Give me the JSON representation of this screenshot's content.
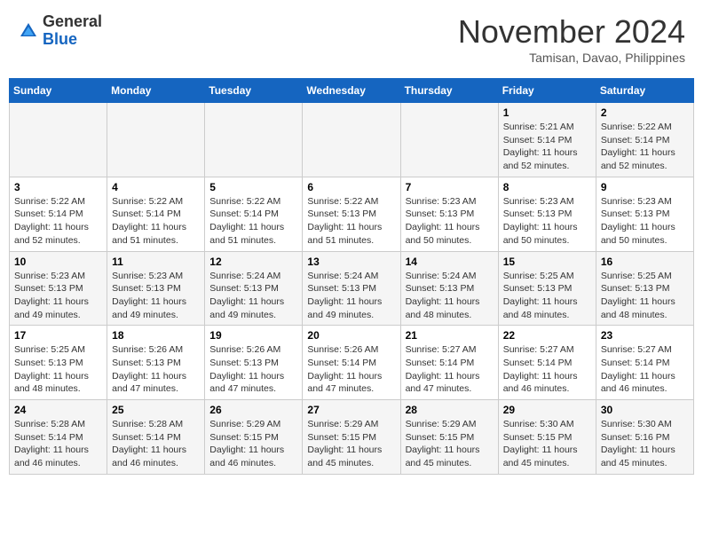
{
  "header": {
    "logo_general": "General",
    "logo_blue": "Blue",
    "month_title": "November 2024",
    "subtitle": "Tamisan, Davao, Philippines"
  },
  "days_of_week": [
    "Sunday",
    "Monday",
    "Tuesday",
    "Wednesday",
    "Thursday",
    "Friday",
    "Saturday"
  ],
  "weeks": [
    {
      "cells": [
        {
          "day": "",
          "detail": ""
        },
        {
          "day": "",
          "detail": ""
        },
        {
          "day": "",
          "detail": ""
        },
        {
          "day": "",
          "detail": ""
        },
        {
          "day": "",
          "detail": ""
        },
        {
          "day": "1",
          "detail": "Sunrise: 5:21 AM\nSunset: 5:14 PM\nDaylight: 11 hours and 52 minutes."
        },
        {
          "day": "2",
          "detail": "Sunrise: 5:22 AM\nSunset: 5:14 PM\nDaylight: 11 hours and 52 minutes."
        }
      ]
    },
    {
      "cells": [
        {
          "day": "3",
          "detail": "Sunrise: 5:22 AM\nSunset: 5:14 PM\nDaylight: 11 hours and 52 minutes."
        },
        {
          "day": "4",
          "detail": "Sunrise: 5:22 AM\nSunset: 5:14 PM\nDaylight: 11 hours and 51 minutes."
        },
        {
          "day": "5",
          "detail": "Sunrise: 5:22 AM\nSunset: 5:14 PM\nDaylight: 11 hours and 51 minutes."
        },
        {
          "day": "6",
          "detail": "Sunrise: 5:22 AM\nSunset: 5:13 PM\nDaylight: 11 hours and 51 minutes."
        },
        {
          "day": "7",
          "detail": "Sunrise: 5:23 AM\nSunset: 5:13 PM\nDaylight: 11 hours and 50 minutes."
        },
        {
          "day": "8",
          "detail": "Sunrise: 5:23 AM\nSunset: 5:13 PM\nDaylight: 11 hours and 50 minutes."
        },
        {
          "day": "9",
          "detail": "Sunrise: 5:23 AM\nSunset: 5:13 PM\nDaylight: 11 hours and 50 minutes."
        }
      ]
    },
    {
      "cells": [
        {
          "day": "10",
          "detail": "Sunrise: 5:23 AM\nSunset: 5:13 PM\nDaylight: 11 hours and 49 minutes."
        },
        {
          "day": "11",
          "detail": "Sunrise: 5:23 AM\nSunset: 5:13 PM\nDaylight: 11 hours and 49 minutes."
        },
        {
          "day": "12",
          "detail": "Sunrise: 5:24 AM\nSunset: 5:13 PM\nDaylight: 11 hours and 49 minutes."
        },
        {
          "day": "13",
          "detail": "Sunrise: 5:24 AM\nSunset: 5:13 PM\nDaylight: 11 hours and 49 minutes."
        },
        {
          "day": "14",
          "detail": "Sunrise: 5:24 AM\nSunset: 5:13 PM\nDaylight: 11 hours and 48 minutes."
        },
        {
          "day": "15",
          "detail": "Sunrise: 5:25 AM\nSunset: 5:13 PM\nDaylight: 11 hours and 48 minutes."
        },
        {
          "day": "16",
          "detail": "Sunrise: 5:25 AM\nSunset: 5:13 PM\nDaylight: 11 hours and 48 minutes."
        }
      ]
    },
    {
      "cells": [
        {
          "day": "17",
          "detail": "Sunrise: 5:25 AM\nSunset: 5:13 PM\nDaylight: 11 hours and 48 minutes."
        },
        {
          "day": "18",
          "detail": "Sunrise: 5:26 AM\nSunset: 5:13 PM\nDaylight: 11 hours and 47 minutes."
        },
        {
          "day": "19",
          "detail": "Sunrise: 5:26 AM\nSunset: 5:13 PM\nDaylight: 11 hours and 47 minutes."
        },
        {
          "day": "20",
          "detail": "Sunrise: 5:26 AM\nSunset: 5:14 PM\nDaylight: 11 hours and 47 minutes."
        },
        {
          "day": "21",
          "detail": "Sunrise: 5:27 AM\nSunset: 5:14 PM\nDaylight: 11 hours and 47 minutes."
        },
        {
          "day": "22",
          "detail": "Sunrise: 5:27 AM\nSunset: 5:14 PM\nDaylight: 11 hours and 46 minutes."
        },
        {
          "day": "23",
          "detail": "Sunrise: 5:27 AM\nSunset: 5:14 PM\nDaylight: 11 hours and 46 minutes."
        }
      ]
    },
    {
      "cells": [
        {
          "day": "24",
          "detail": "Sunrise: 5:28 AM\nSunset: 5:14 PM\nDaylight: 11 hours and 46 minutes."
        },
        {
          "day": "25",
          "detail": "Sunrise: 5:28 AM\nSunset: 5:14 PM\nDaylight: 11 hours and 46 minutes."
        },
        {
          "day": "26",
          "detail": "Sunrise: 5:29 AM\nSunset: 5:15 PM\nDaylight: 11 hours and 46 minutes."
        },
        {
          "day": "27",
          "detail": "Sunrise: 5:29 AM\nSunset: 5:15 PM\nDaylight: 11 hours and 45 minutes."
        },
        {
          "day": "28",
          "detail": "Sunrise: 5:29 AM\nSunset: 5:15 PM\nDaylight: 11 hours and 45 minutes."
        },
        {
          "day": "29",
          "detail": "Sunrise: 5:30 AM\nSunset: 5:15 PM\nDaylight: 11 hours and 45 minutes."
        },
        {
          "day": "30",
          "detail": "Sunrise: 5:30 AM\nSunset: 5:16 PM\nDaylight: 11 hours and 45 minutes."
        }
      ]
    }
  ]
}
